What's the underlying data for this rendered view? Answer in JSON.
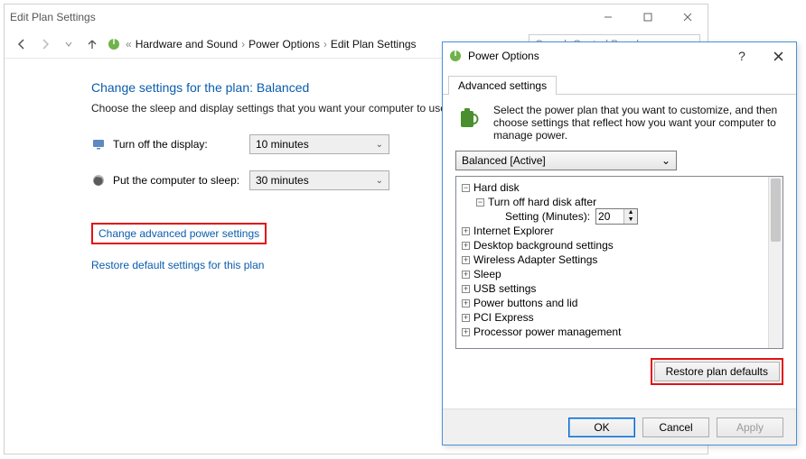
{
  "main": {
    "title": "Edit Plan Settings",
    "breadcrumb": [
      "Hardware and Sound",
      "Power Options",
      "Edit Plan Settings"
    ],
    "search_placeholder": "Search Control Panel",
    "heading_prefix": "Change settings for the plan: ",
    "plan_name": "Balanced",
    "instruction": "Choose the sleep and display settings that you want your computer to use.",
    "settings": [
      {
        "label": "Turn off the display:",
        "value": "10 minutes"
      },
      {
        "label": "Put the computer to sleep:",
        "value": "30 minutes"
      }
    ],
    "link_advanced": "Change advanced power settings",
    "link_restore": "Restore default settings for this plan"
  },
  "popup": {
    "title": "Power Options",
    "tab_label": "Advanced settings",
    "description": "Select the power plan that you want to customize, and then choose settings that reflect how you want your computer to manage power.",
    "plan_selector": "Balanced [Active]",
    "tree": {
      "root": {
        "label": "Hard disk",
        "expanded": true
      },
      "child": {
        "label": "Turn off hard disk after",
        "expanded": true
      },
      "setting_label": "Setting (Minutes):",
      "setting_value": "20",
      "nodes": [
        "Internet Explorer",
        "Desktop background settings",
        "Wireless Adapter Settings",
        "Sleep",
        "USB settings",
        "Power buttons and lid",
        "PCI Express",
        "Processor power management"
      ]
    },
    "restore_btn": "Restore plan defaults",
    "buttons": {
      "ok": "OK",
      "cancel": "Cancel",
      "apply": "Apply"
    }
  }
}
